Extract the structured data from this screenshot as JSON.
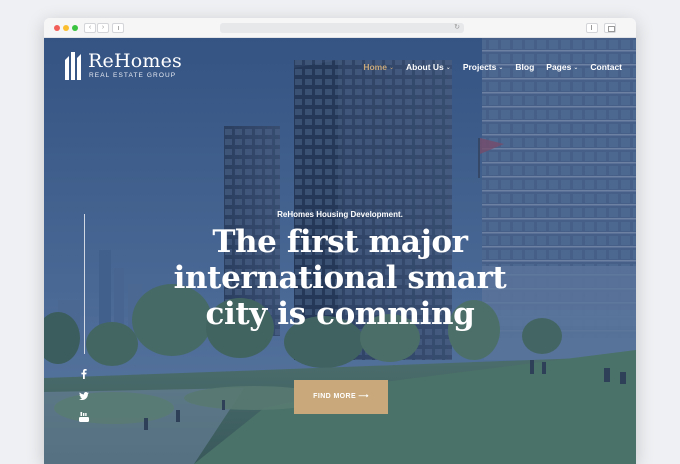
{
  "browser": {
    "back_glyph": "‹",
    "forward_glyph": "›",
    "reload_glyph": "↻"
  },
  "site": {
    "brand": "ReHomes",
    "tagline": "REAL ESTATE GROUP"
  },
  "nav": {
    "items": [
      {
        "label": "Home",
        "has_dropdown": true,
        "active": true
      },
      {
        "label": "About Us",
        "has_dropdown": true,
        "active": false
      },
      {
        "label": "Projects",
        "has_dropdown": true,
        "active": false
      },
      {
        "label": "Blog",
        "has_dropdown": false,
        "active": false
      },
      {
        "label": "Pages",
        "has_dropdown": true,
        "active": false
      },
      {
        "label": "Contact",
        "has_dropdown": false,
        "active": false
      }
    ],
    "chevron_glyph": "⌄"
  },
  "hero": {
    "eyebrow": "ReHomes Housing Development.",
    "headline_lines": [
      "The first major",
      "international smart",
      "city is comming"
    ],
    "cta_label": "FIND MORE ⟶"
  },
  "social": {
    "icons": [
      "facebook-icon",
      "twitter-icon",
      "youtube-icon"
    ]
  },
  "colors": {
    "accent": "#c9a97c",
    "overlay_blue": "#3c5a87",
    "text_light": "#ffffff"
  }
}
